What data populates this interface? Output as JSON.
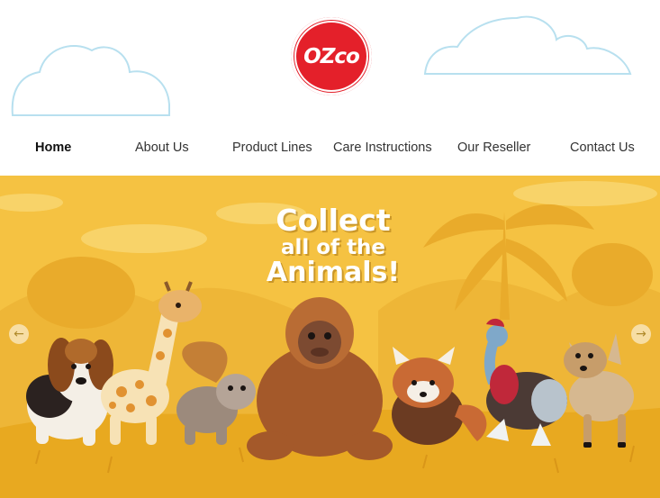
{
  "brand": {
    "logo_text": "OZco"
  },
  "nav": {
    "items": [
      {
        "label": "Home",
        "active": true
      },
      {
        "label": "About Us"
      },
      {
        "label": "Product Lines"
      },
      {
        "label": "Care Instructions"
      },
      {
        "label": "Our Reseller"
      },
      {
        "label": "Contact Us"
      }
    ]
  },
  "hero": {
    "line1": "Collect",
    "line2": "all of the",
    "line3": "Animals!",
    "prev_icon": "arrow-left-icon",
    "next_icon": "arrow-right-icon",
    "prev_glyph": "←",
    "next_glyph": "→",
    "colors": {
      "background": "#f5c242",
      "ground": "#e8a920",
      "accent": "#e4202a"
    }
  }
}
